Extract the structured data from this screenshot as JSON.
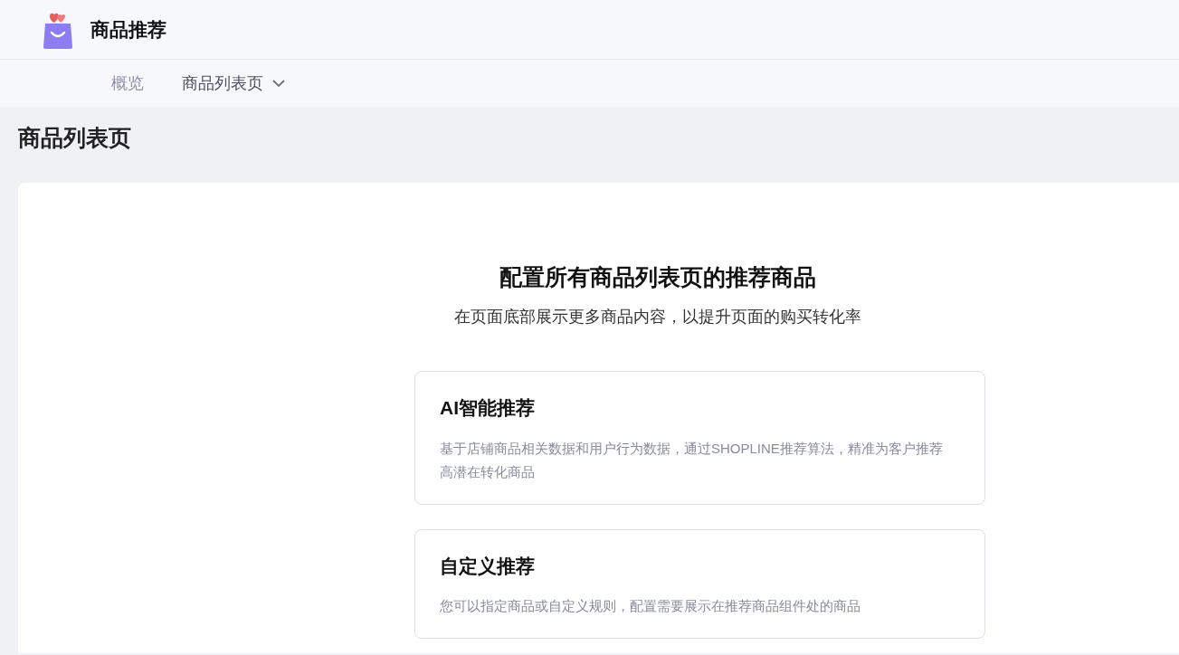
{
  "app": {
    "title": "商品推荐"
  },
  "nav": [
    {
      "label": "概览",
      "selected": false,
      "has_menu": false
    },
    {
      "label": "商品列表页",
      "selected": true,
      "has_menu": true
    }
  ],
  "page_title": "商品列表页",
  "panel": {
    "heading": "配置所有商品列表页的推荐商品",
    "subtitle": "在页面底部展示更多商品内容，以提升页面的购买转化率",
    "options": [
      {
        "title": "AI智能推荐",
        "description": "基于店铺商品相关数据和用户行为数据，通过SHOPLINE推荐算法，精准为客户推荐高潜在转化商品"
      },
      {
        "title": "自定义推荐",
        "description": "您可以指定商品或自定义规则，配置需要展示在推荐商品组件处的商品"
      }
    ]
  }
}
